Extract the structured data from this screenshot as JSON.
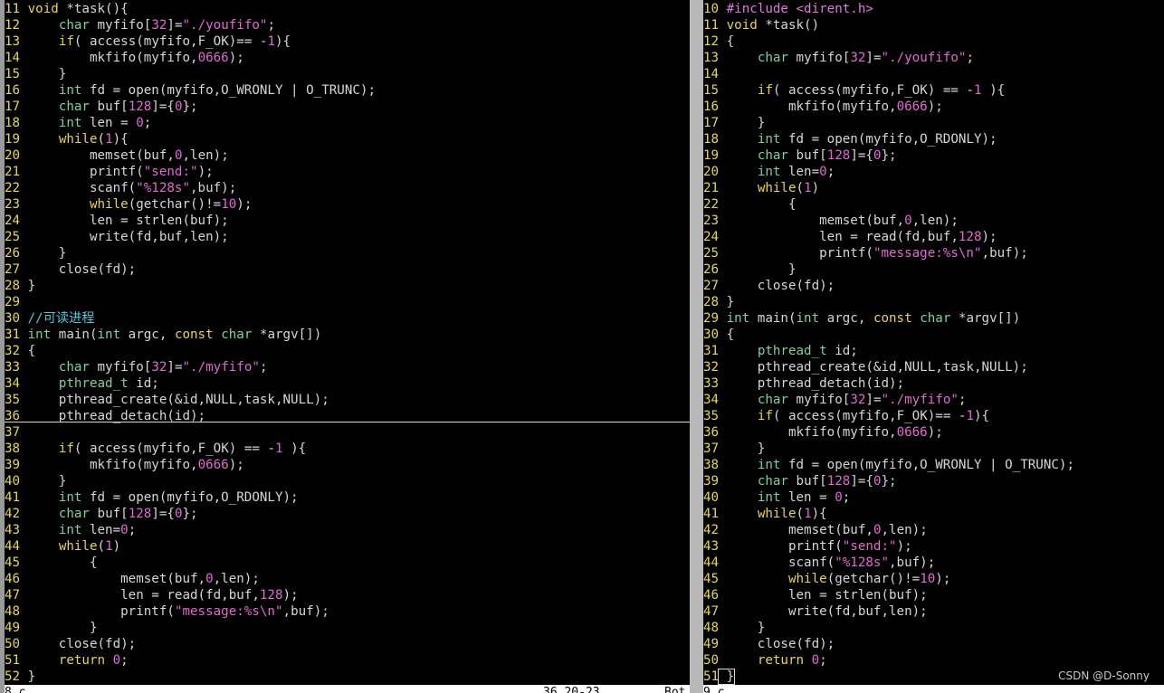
{
  "left_pane": {
    "top_lines": [
      "11 void *task(){",
      "12     char myfifo[32]=\"./youfifo\";",
      "13     if( access(myfifo,F_OK)== -1){",
      "14         mkfifo(myfifo,0666);",
      "15     }",
      "16     int fd = open(myfifo,O_WRONLY | O_TRUNC);",
      "17     char buf[128]={0};",
      "18     int len = 0;",
      "19     while(1){",
      "20         memset(buf,0,len);",
      "21         printf(\"send:\");",
      "22         scanf(\"%128s\",buf);",
      "23         while(getchar()!=10);",
      "24         len = strlen(buf);",
      "25         write(fd,buf,len);",
      "26     }",
      "27     close(fd);",
      "28 }",
      "29",
      "30 //可读进程",
      "31 int main(int argc, const char *argv[])",
      "32 {",
      "33     char myfifo[32]=\"./myfifo\";",
      "34     pthread_t id;",
      "35     pthread_create(&id,NULL,task,NULL);",
      "36     pthread_detach(id);"
    ],
    "bottom_lines": [
      "37",
      "38     if( access(myfifo,F_OK) == -1 ){",
      "39         mkfifo(myfifo,0666);",
      "40     }",
      "41     int fd = open(myfifo,O_RDONLY);",
      "42     char buf[128]={0};",
      "43     int len=0;",
      "44     while(1)",
      "45         {",
      "46             memset(buf,0,len);",
      "47             len = read(fd,buf,128);",
      "48             printf(\"message:%s\\n\",buf);",
      "49         }",
      "50     close(fd);",
      "51     return 0;",
      "52 }"
    ],
    "status_left": "8.c",
    "status_pos": "36,20-23",
    "status_scroll": "Bot"
  },
  "right_pane": {
    "lines": [
      "10 #include <dirent.h>",
      "11 void *task()",
      "12 {",
      "13     char myfifo[32]=\"./youfifo\";",
      "14",
      "15     if( access(myfifo,F_OK) == -1 ){",
      "16         mkfifo(myfifo,0666);",
      "17     }",
      "18     int fd = open(myfifo,O_RDONLY);",
      "19     char buf[128]={0};",
      "20     int len=0;",
      "21     while(1)",
      "22         {",
      "23             memset(buf,0,len);",
      "24             len = read(fd,buf,128);",
      "25             printf(\"message:%s\\n\",buf);",
      "26         }",
      "27     close(fd);",
      "28 }",
      "29 int main(int argc, const char *argv[])",
      "30 {",
      "31     pthread_t id;",
      "32     pthread_create(&id,NULL,task,NULL);",
      "33     pthread_detach(id);",
      "34     char myfifo[32]=\"./myfifo\";",
      "35     if( access(myfifo,F_OK)== -1){",
      "36         mkfifo(myfifo,0666);",
      "37     }",
      "38     int fd = open(myfifo,O_WRONLY | O_TRUNC);",
      "39     char buf[128]={0};",
      "40     int len = 0;",
      "41     while(1){",
      "42         memset(buf,0,len);",
      "43         printf(\"send:\");",
      "44         scanf(\"%128s\",buf);",
      "45         while(getchar()!=10);",
      "46         len = strlen(buf);",
      "47         write(fd,buf,len);",
      "48     }",
      "49     close(fd);",
      "50     return 0;",
      "51 }"
    ],
    "status_left": "9.c"
  },
  "watermark": "CSDN @D-Sonny",
  "colors": {
    "background": "#000000",
    "line_number": "#e6d84d",
    "keyword": "#e8d44d",
    "type": "#7fd0a0",
    "string": "#e06ad0",
    "comment": "#4fc9e0",
    "text": "#d6d6d6"
  }
}
